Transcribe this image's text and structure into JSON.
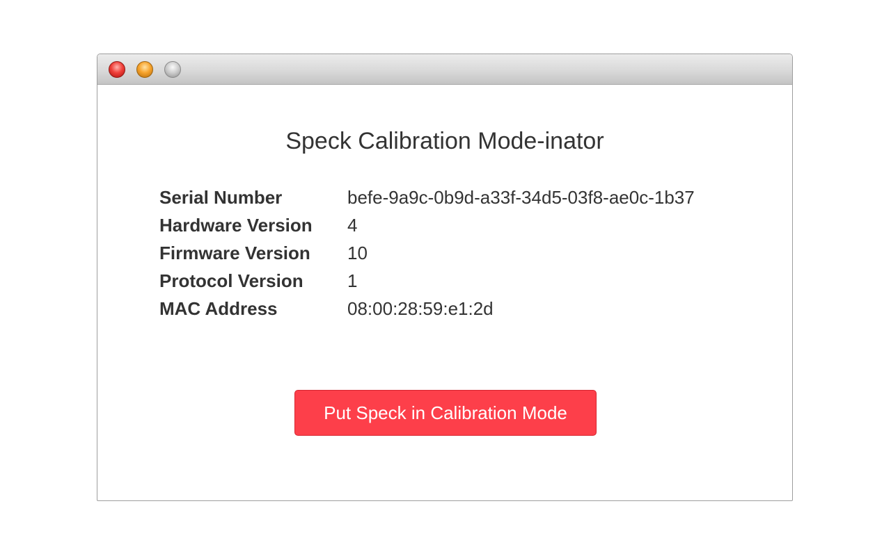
{
  "window": {
    "controls": {
      "close_icon": "close-icon",
      "minimize_icon": "minimize-icon",
      "zoom_icon": "zoom-icon"
    }
  },
  "main": {
    "title": "Speck Calibration Mode-inator",
    "info": [
      {
        "label": "Serial Number",
        "value": "befe-9a9c-0b9d-a33f-34d5-03f8-ae0c-1b37"
      },
      {
        "label": "Hardware Version",
        "value": "4"
      },
      {
        "label": "Firmware Version",
        "value": "10"
      },
      {
        "label": "Protocol Version",
        "value": "1"
      },
      {
        "label": "MAC Address",
        "value": "08:00:28:59:e1:2d"
      }
    ],
    "calibration_button_label": "Put Speck in Calibration Mode"
  },
  "colors": {
    "button_bg": "#fd3f4a",
    "button_text": "#ffffff",
    "text": "#333333"
  }
}
